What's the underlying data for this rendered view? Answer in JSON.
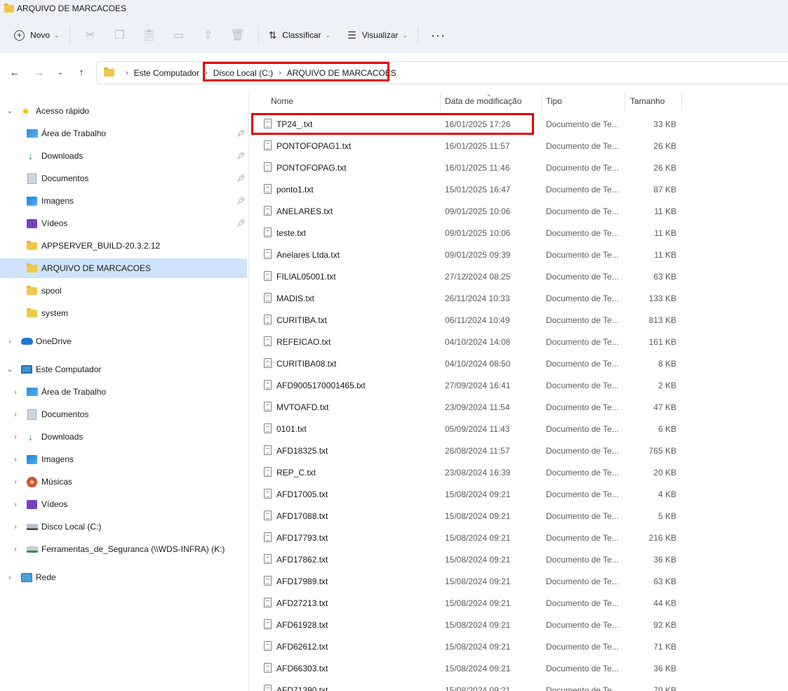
{
  "window": {
    "title": "ARQUIVO DE MARCACOES"
  },
  "commandbar": {
    "new_label": "Novo",
    "sort_label": "Classificar",
    "view_label": "Visualizar",
    "icons": [
      "cut-icon",
      "copy-icon",
      "paste-icon",
      "rename-icon",
      "share-icon",
      "delete-icon"
    ]
  },
  "address": {
    "crumbs": [
      "Este Computador",
      "Disco Local (C:)",
      "ARQUIVO DE MARCACOES"
    ]
  },
  "sidebar": {
    "quick_access": "Acesso rápido",
    "quick_items": [
      "Área de Trabalho",
      "Downloads",
      "Documentos",
      "Imagens",
      "Vídeos",
      "APPSERVER_BUILD-20.3.2.12",
      "ARQUIVO DE MARCACOES",
      "spool",
      "system"
    ],
    "onedrive": "OneDrive",
    "this_pc": "Este Computador",
    "pc_items": [
      "Área de Trabalho",
      "Documentos",
      "Downloads",
      "Imagens",
      "Músicas",
      "Vídeos",
      "Disco Local (C:)",
      "Ferramentas_de_Seguranca (\\\\WDS-INFRA) (K:)"
    ],
    "network": "Rede"
  },
  "filelist": {
    "headers": {
      "name": "Nome",
      "date": "Data de modificação",
      "type": "Tipo",
      "size": "Tamanho"
    },
    "rows": [
      {
        "name": "TP24_.txt",
        "date": "16/01/2025 17:26",
        "type": "Documento de Te...",
        "size": "33 KB"
      },
      {
        "name": "PONTOFOPAG1.txt",
        "date": "16/01/2025 11:57",
        "type": "Documento de Te...",
        "size": "26 KB"
      },
      {
        "name": "PONTOFOPAG.txt",
        "date": "16/01/2025 11:46",
        "type": "Documento de Te...",
        "size": "26 KB"
      },
      {
        "name": "ponto1.txt",
        "date": "15/01/2025 16:47",
        "type": "Documento de Te...",
        "size": "87 KB"
      },
      {
        "name": "ANELARES.txt",
        "date": "09/01/2025 10:06",
        "type": "Documento de Te...",
        "size": "11 KB"
      },
      {
        "name": "teste.txt",
        "date": "09/01/2025 10:06",
        "type": "Documento de Te...",
        "size": "11 KB"
      },
      {
        "name": "Anelares Ltda.txt",
        "date": "09/01/2025 09:39",
        "type": "Documento de Te...",
        "size": "11 KB"
      },
      {
        "name": "FILIAL05001.txt",
        "date": "27/12/2024 08:25",
        "type": "Documento de Te...",
        "size": "63 KB"
      },
      {
        "name": "MADIS.txt",
        "date": "26/11/2024 10:33",
        "type": "Documento de Te...",
        "size": "133 KB"
      },
      {
        "name": "CURITIBA.txt",
        "date": "06/11/2024 10:49",
        "type": "Documento de Te...",
        "size": "813 KB"
      },
      {
        "name": "REFEICAO.txt",
        "date": "04/10/2024 14:08",
        "type": "Documento de Te...",
        "size": "161 KB"
      },
      {
        "name": "CURITIBA08.txt",
        "date": "04/10/2024 08:50",
        "type": "Documento de Te...",
        "size": "8 KB"
      },
      {
        "name": "AFD9005170001465.txt",
        "date": "27/09/2024 16:41",
        "type": "Documento de Te...",
        "size": "2 KB"
      },
      {
        "name": "MVTOAFD.txt",
        "date": "23/09/2024 11:54",
        "type": "Documento de Te...",
        "size": "47 KB"
      },
      {
        "name": "0101.txt",
        "date": "05/09/2024 11:43",
        "type": "Documento de Te...",
        "size": "6 KB"
      },
      {
        "name": "AFD18325.txt",
        "date": "26/08/2024 11:57",
        "type": "Documento de Te...",
        "size": "765 KB"
      },
      {
        "name": "REP_C.txt",
        "date": "23/08/2024 16:39",
        "type": "Documento de Te...",
        "size": "20 KB"
      },
      {
        "name": "AFD17005.txt",
        "date": "15/08/2024 09:21",
        "type": "Documento de Te...",
        "size": "4 KB"
      },
      {
        "name": "AFD17088.txt",
        "date": "15/08/2024 09:21",
        "type": "Documento de Te...",
        "size": "5 KB"
      },
      {
        "name": "AFD17793.txt",
        "date": "15/08/2024 09:21",
        "type": "Documento de Te...",
        "size": "216 KB"
      },
      {
        "name": "AFD17862.txt",
        "date": "15/08/2024 09:21",
        "type": "Documento de Te...",
        "size": "36 KB"
      },
      {
        "name": "AFD17989.txt",
        "date": "15/08/2024 09:21",
        "type": "Documento de Te...",
        "size": "63 KB"
      },
      {
        "name": "AFD27213.txt",
        "date": "15/08/2024 09:21",
        "type": "Documento de Te...",
        "size": "44 KB"
      },
      {
        "name": "AFD61928.txt",
        "date": "15/08/2024 09:21",
        "type": "Documento de Te...",
        "size": "92 KB"
      },
      {
        "name": "AFD62612.txt",
        "date": "15/08/2024 09:21",
        "type": "Documento de Te...",
        "size": "71 KB"
      },
      {
        "name": "AFD66303.txt",
        "date": "15/08/2024 09:21",
        "type": "Documento de Te...",
        "size": "36 KB"
      },
      {
        "name": "AFD71390.txt",
        "date": "15/08/2024 09:21",
        "type": "Documento de Te...",
        "size": "70 KB"
      }
    ]
  },
  "colors": {
    "highlight": "#e00000",
    "selected": "#cfe4fa",
    "chrome": "#eef2f8"
  }
}
